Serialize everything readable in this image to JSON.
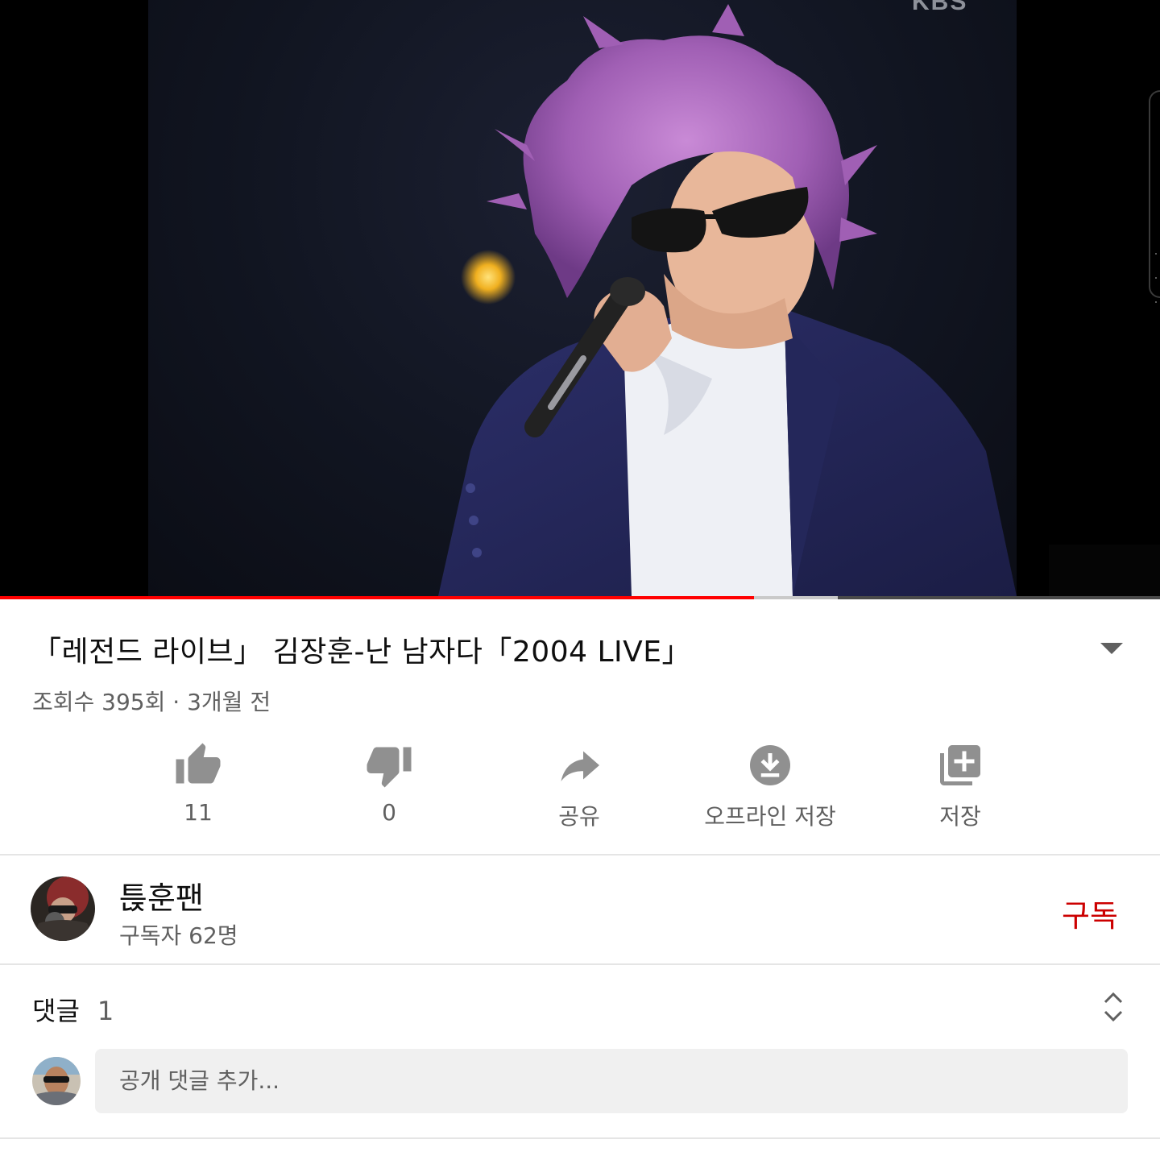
{
  "player": {
    "watermark": "KBS",
    "played_fraction": 0.65,
    "buffered_fraction": 0.722
  },
  "video": {
    "title": "「레전드 라이브」 김장훈-난 남자다「2004 LIVE」",
    "meta": "조회수 395회 · 3개월 전"
  },
  "actions": [
    {
      "icon": "thumb-up-icon",
      "label": "11"
    },
    {
      "icon": "thumb-down-icon",
      "label": "0"
    },
    {
      "icon": "share-icon",
      "label": "공유"
    },
    {
      "icon": "download-icon",
      "label": "오프라인 저장"
    },
    {
      "icon": "add-to-playlist-icon",
      "label": "저장"
    }
  ],
  "channel": {
    "name": "튽훈팬",
    "subscribers": "구독자 62명",
    "subscribe_label": "구독",
    "subscribe_color": "#cc0000"
  },
  "comments": {
    "label": "댓글",
    "count": "1",
    "input_placeholder": "공개 댓글 추가..."
  },
  "colors": {
    "progress_played": "#ff0000",
    "icon_gray": "#909090",
    "text_secondary": "#606060"
  }
}
